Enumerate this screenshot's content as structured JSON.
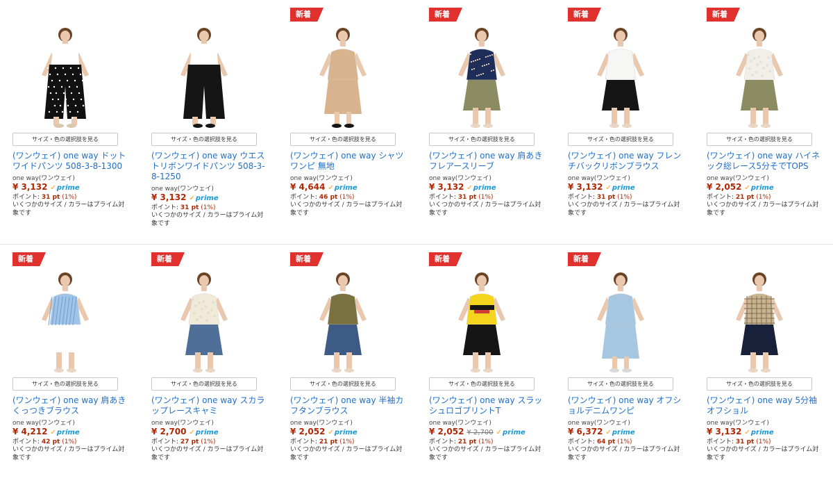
{
  "colors": {
    "badge_bg": "#e0312e",
    "title_link": "#1f6ec8",
    "price": "#b12704",
    "prime": "#1a98d5",
    "prime_check": "#f39a1b"
  },
  "labels": {
    "new_badge": "新着",
    "variation_button": "サイズ・色の選択肢を見る",
    "prime_text": "prime",
    "prime_icon": "check-icon",
    "points_prefix": "ポイント:",
    "availability": "いくつかのサイズ / カラーはプライム対象です"
  },
  "products": [
    {
      "title": "(ワンウェイ) one way ドットワイドパンツ 508-3-8-1300",
      "brand": "one way(ワンウェイ)",
      "price": "¥ 3,132",
      "points": "31 pt",
      "points_pct": "(1%)",
      "is_new": false,
      "image": "polka-dot-wide-pants",
      "palette": {
        "top": "#ffffff",
        "bottom": "#111111",
        "shoe": "#d9c8ad",
        "pattern": "dot"
      }
    },
    {
      "title": "(ワンウェイ) one way ウエストリボンワイドパンツ 508-3-8-1250",
      "brand": "one way(ワンウェイ)",
      "price": "¥ 3,132",
      "points": "31 pt",
      "points_pct": "(1%)",
      "is_new": false,
      "image": "black-wide-pants",
      "palette": {
        "top": "#ffffff",
        "bottom": "#151515",
        "shoe": "#151515",
        "pattern": "plain"
      }
    },
    {
      "title": "(ワンウェイ) one way シャツワンピ 無地",
      "brand": "one way(ワンウェイ)",
      "price": "¥ 4,644",
      "points": "46 pt",
      "points_pct": "(1%)",
      "is_new": true,
      "image": "beige-shirt-dress",
      "palette": {
        "top": "#d8b48e",
        "bottom": "#d8b48e",
        "shoe": "#151515",
        "pattern": "dress"
      }
    },
    {
      "title": "(ワンウェイ) one way 肩あきフレアースリーブ",
      "brand": "one way(ワンウェイ)",
      "price": "¥ 3,132",
      "points": "31 pt",
      "points_pct": "(1%)",
      "is_new": true,
      "image": "navy-floral-cold-shoulder-top",
      "palette": {
        "top": "#1f2d5b",
        "bottom": "#8c8c62",
        "shoe": "#e8d5c4",
        "pattern": "floral"
      }
    },
    {
      "title": "(ワンウェイ) one way フレンチバックリボンブラウス",
      "brand": "one way(ワンウェイ)",
      "price": "¥ 3,132",
      "points": "31 pt",
      "points_pct": "(1%)",
      "is_new": true,
      "image": "white-blouse-black-shorts",
      "palette": {
        "top": "#f6f6f4",
        "bottom": "#151515",
        "shoe": "#e8d5c4",
        "pattern": "plain"
      }
    },
    {
      "title": "(ワンウェイ) one way ハイネック総レース5分そでTOPS",
      "brand": "one way(ワンウェイ)",
      "price": "¥ 2,052",
      "points": "21 pt",
      "points_pct": "(1%)",
      "is_new": true,
      "image": "white-lace-top-olive-skirt",
      "palette": {
        "top": "#f2efe8",
        "bottom": "#8c8c62",
        "shoe": "#e8d5c4",
        "pattern": "lace"
      }
    },
    {
      "title": "(ワンウェイ) one way 肩あきくっつきブラウス",
      "brand": "one way(ワンウェイ)",
      "price": "¥ 4,212",
      "points": "42 pt",
      "points_pct": "(1%)",
      "is_new": true,
      "image": "blue-stripe-off-shoulder-blouse",
      "palette": {
        "top": "#9fc4e8",
        "bottom": "#ffffff",
        "shoe": "#e8d5c4",
        "pattern": "stripe"
      }
    },
    {
      "title": "(ワンウェイ) one way スカラップレースキャミ",
      "brand": "one way(ワンウェイ)",
      "price": "¥ 2,700",
      "points": "27 pt",
      "points_pct": "(1%)",
      "is_new": true,
      "image": "cream-lace-camisole-jeans",
      "palette": {
        "top": "#f0ead8",
        "bottom": "#4f6f99",
        "shoe": "#e8d5c4",
        "pattern": "lace"
      }
    },
    {
      "title": "(ワンウェイ) one way 半袖カフタンブラウス",
      "brand": "one way(ワンウェイ)",
      "price": "¥ 2,052",
      "points": "21 pt",
      "points_pct": "(1%)",
      "is_new": true,
      "image": "khaki-blouse-denim-skirt",
      "palette": {
        "top": "#7a7140",
        "bottom": "#3d5b85",
        "shoe": "#e8d5c4",
        "pattern": "plain"
      }
    },
    {
      "title": "(ワンウェイ) one way スラッシュロゴプリントT",
      "brand": "one way(ワンウェイ)",
      "price": "¥ 2,052",
      "list_price": "¥ 2,700",
      "points": "21 pt",
      "points_pct": "(1%)",
      "is_new": true,
      "image": "yellow-logo-tshirt",
      "palette": {
        "top": "#f5d41d",
        "bottom": "#151515",
        "shoe": "#e8d5c4",
        "pattern": "logo"
      }
    },
    {
      "title": "(ワンウェイ) one way オフショルデニムワンピ",
      "brand": "one way(ワンウェイ)",
      "price": "¥ 6,372",
      "points": "64 pt",
      "points_pct": "(1%)",
      "is_new": true,
      "image": "light-denim-dress",
      "palette": {
        "top": "#a7c6df",
        "bottom": "#a7c6df",
        "shoe": "#d8d8d8",
        "pattern": "dress"
      }
    },
    {
      "title": "(ワンウェイ) one way 5分袖オフショル",
      "brand": "one way(ワンウェイ)",
      "price": "¥ 3,132",
      "points": "31 pt",
      "points_pct": "(1%)",
      "is_new": false,
      "image": "plaid-off-shoulder-top",
      "palette": {
        "top": "#c8b48d",
        "bottom": "#18203a",
        "shoe": "#e8d5c4",
        "pattern": "plaid"
      }
    }
  ]
}
